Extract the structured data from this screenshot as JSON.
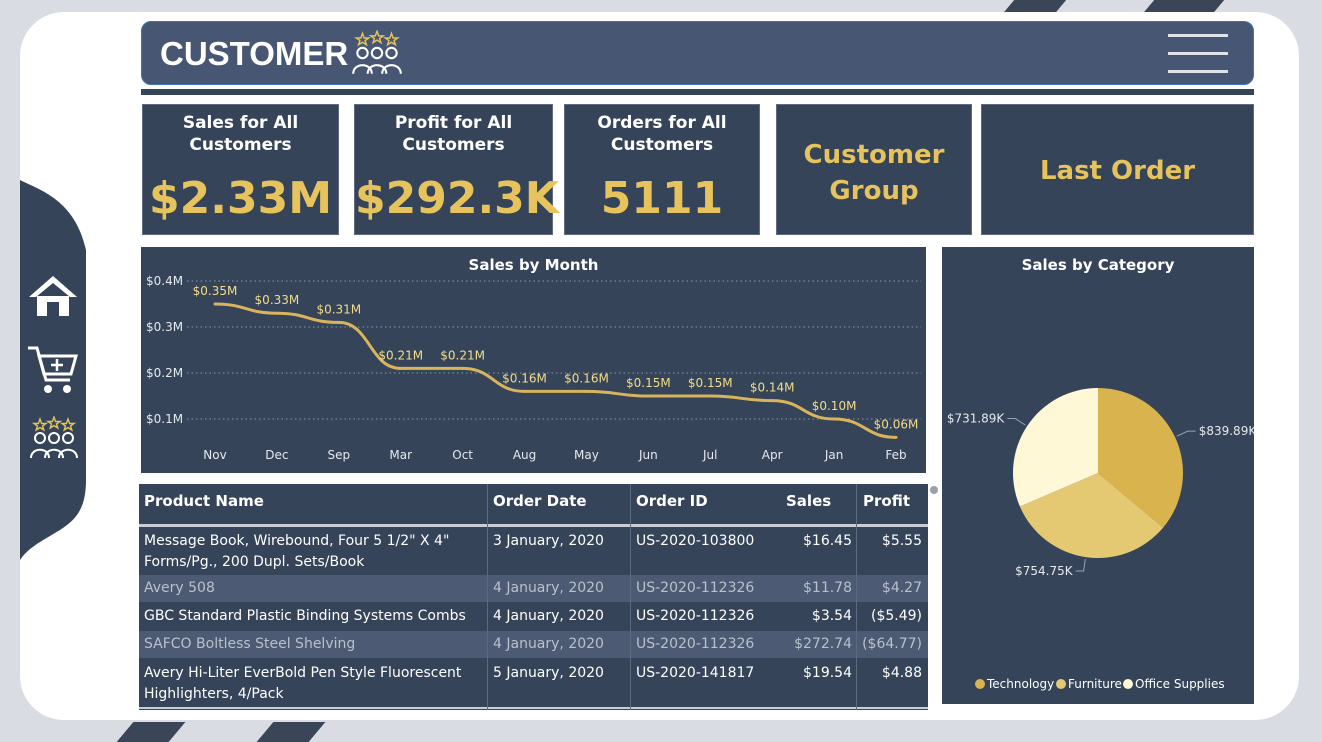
{
  "header": {
    "title": "CUSTOMER",
    "menu_icon": "hamburger-icon",
    "title_icon": "customers-rating-icon"
  },
  "nav": [
    {
      "name": "home-icon"
    },
    {
      "name": "cart-add-icon"
    },
    {
      "name": "customers-rating-icon"
    }
  ],
  "kpis": {
    "sales": {
      "label_line1": "Sales for All",
      "label_line2": "Customers",
      "value": "$2.33M"
    },
    "profit": {
      "label_line1": "Profit for All",
      "label_line2": "Customers",
      "value": "$292.3K"
    },
    "orders": {
      "label_line1": "Orders for All",
      "label_line2": "Customers",
      "value": "5111"
    },
    "customer_group": {
      "line1": "Customer",
      "line2": "Group"
    },
    "last_order": {
      "text": "Last Order"
    }
  },
  "colors": {
    "accent": "#e6c35c",
    "panel": "#354459",
    "line": "#d9b45c"
  },
  "chart_data": [
    {
      "type": "line",
      "title": "Sales by Month",
      "categories": [
        "Nov",
        "Dec",
        "Sep",
        "Mar",
        "Oct",
        "Aug",
        "May",
        "Jun",
        "Jul",
        "Apr",
        "Jan",
        "Feb"
      ],
      "values": [
        0.35,
        0.33,
        0.31,
        0.21,
        0.21,
        0.16,
        0.16,
        0.15,
        0.15,
        0.14,
        0.1,
        0.06
      ],
      "data_labels": [
        "$0.35M",
        "$0.33M",
        "$0.31M",
        "$0.21M",
        "$0.21M",
        "$0.16M",
        "$0.16M",
        "$0.15M",
        "$0.15M",
        "$0.14M",
        "$0.10M",
        "$0.06M"
      ],
      "y_ticks": [
        "$0.4M",
        "$0.3M",
        "$0.2M",
        "$0.1M"
      ],
      "y_tick_values": [
        0.4,
        0.3,
        0.2,
        0.1
      ],
      "ylim": [
        0.05,
        0.4
      ],
      "grid": true
    },
    {
      "type": "pie",
      "title": "Sales by Category",
      "categories": [
        "Technology",
        "Furniture",
        "Office Supplies"
      ],
      "values": [
        839.89,
        754.75,
        731.89
      ],
      "data_labels": [
        "$839.89K",
        "$754.75K",
        "$731.89K"
      ],
      "colors": [
        "#d9b34e",
        "#e4c972",
        "#fff8d6"
      ],
      "legend_position": "bottom"
    }
  ],
  "table": {
    "headers": [
      "Product Name",
      "Order Date",
      "Order ID",
      "Sales",
      "Profit"
    ],
    "rows": [
      {
        "product": "Message Book, Wirebound, Four 5 1/2\" X 4\" Forms/Pg., 200 Dupl. Sets/Book",
        "date": "3 January, 2020",
        "id": "US-2020-103800",
        "sales": "$16.45",
        "profit": "$5.55"
      },
      {
        "product": "Avery 508",
        "date": "4 January, 2020",
        "id": "US-2020-112326",
        "sales": "$11.78",
        "profit": "$4.27"
      },
      {
        "product": "GBC Standard Plastic Binding Systems Combs",
        "date": "4 January, 2020",
        "id": "US-2020-112326",
        "sales": "$3.54",
        "profit": "($5.49)"
      },
      {
        "product": "SAFCO Boltless Steel Shelving",
        "date": "4 January, 2020",
        "id": "US-2020-112326",
        "sales": "$272.74",
        "profit": "($64.77)"
      },
      {
        "product": "Avery Hi-Liter EverBold Pen Style Fluorescent Highlighters, 4/Pack",
        "date": "5 January, 2020",
        "id": "US-2020-141817",
        "sales": "$19.54",
        "profit": "$4.88"
      }
    ]
  }
}
